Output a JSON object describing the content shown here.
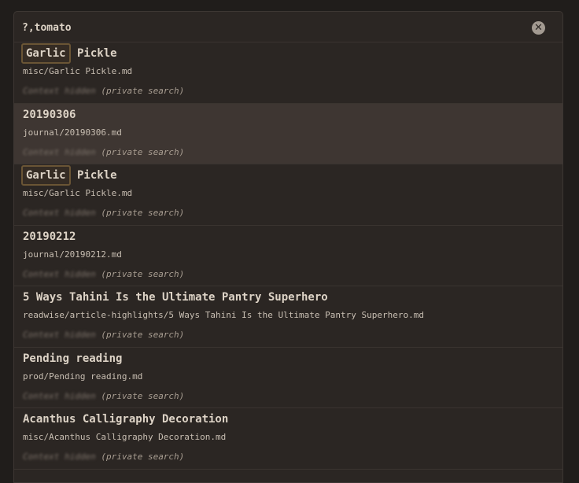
{
  "search": {
    "query": "?,tomato",
    "clear_label": "✕"
  },
  "results": [
    {
      "title_highlight": "Garlic",
      "title_rest": " Pickle",
      "path": "misc/Garlic Pickle.md",
      "context_blurred": "Context hidden",
      "context_note": " (private search)",
      "selected": false
    },
    {
      "title_highlight": "",
      "title_rest": "20190306",
      "path": "journal/20190306.md",
      "context_blurred": "Context hidden",
      "context_note": " (private search)",
      "selected": true
    },
    {
      "title_highlight": "Garlic",
      "title_rest": " Pickle",
      "path": "misc/Garlic Pickle.md",
      "context_blurred": "Context hidden",
      "context_note": " (private search)",
      "selected": false
    },
    {
      "title_highlight": "",
      "title_rest": "20190212",
      "path": "journal/20190212.md",
      "context_blurred": "Context hidden",
      "context_note": " (private search)",
      "selected": false
    },
    {
      "title_highlight": "",
      "title_rest": "5 Ways Tahini Is the Ultimate Pantry Superhero",
      "path": "readwise/article-highlights/5 Ways Tahini Is the Ultimate Pantry Superhero.md",
      "context_blurred": "Context hidden",
      "context_note": " (private search)",
      "selected": false
    },
    {
      "title_highlight": "",
      "title_rest": "Pending reading",
      "path": "prod/Pending reading.md",
      "context_blurred": "Context hidden",
      "context_note": " (private search)",
      "selected": false
    },
    {
      "title_highlight": "",
      "title_rest": "Acanthus Calligraphy Decoration",
      "path": "misc/Acanthus Calligraphy Decoration.md",
      "context_blurred": "Context hidden",
      "context_note": " (private search)",
      "selected": false
    }
  ]
}
